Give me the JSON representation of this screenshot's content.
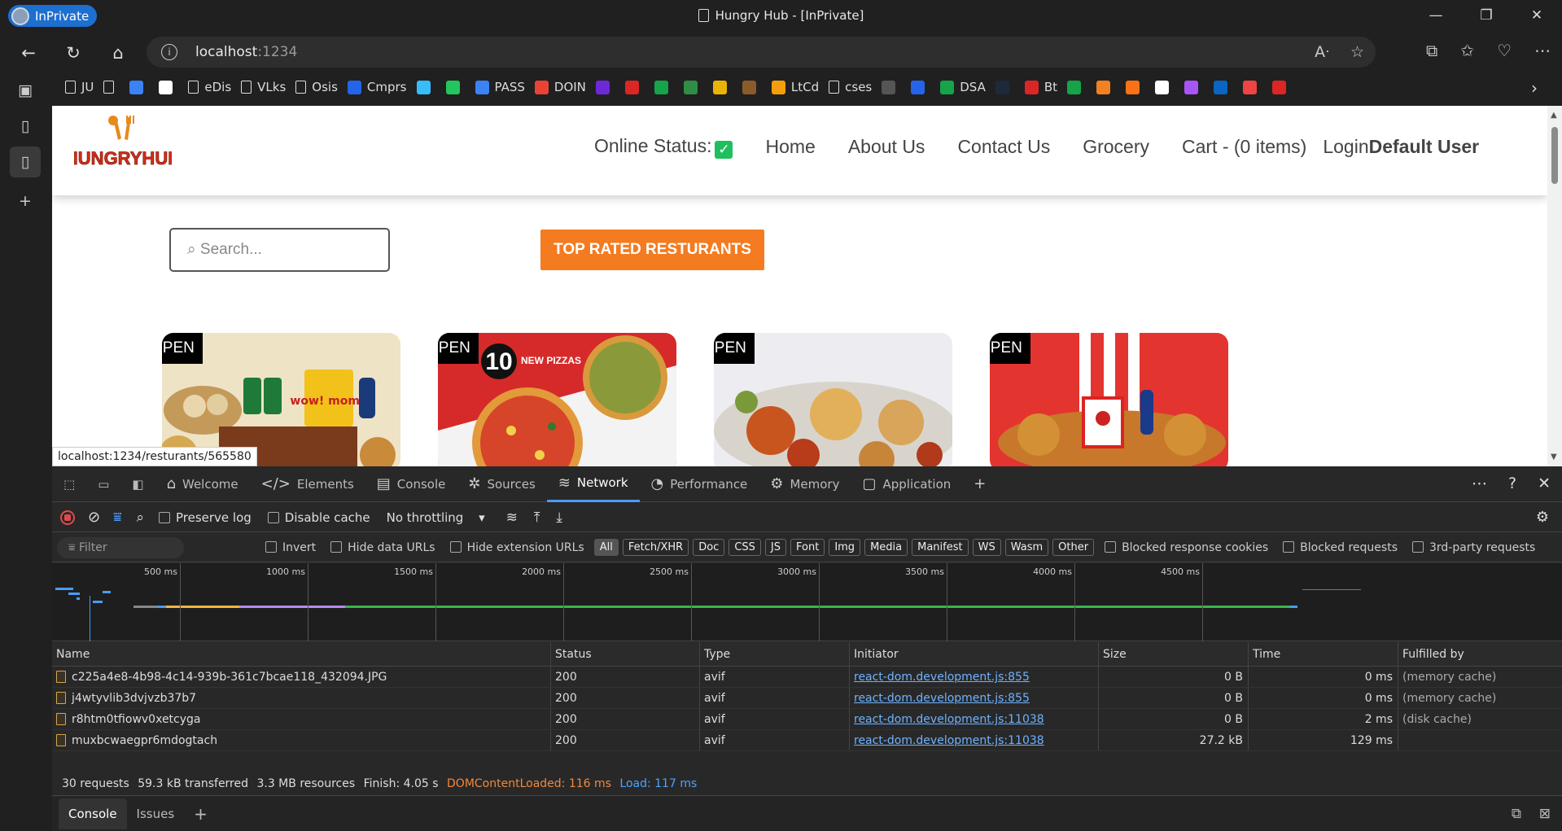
{
  "window": {
    "profile": "InPrivate",
    "title": "Hungry Hub - [InPrivate]"
  },
  "address": {
    "host": "localhost",
    "port": ":1234"
  },
  "bookmarks": [
    {
      "label": "JU",
      "icon": "doc-icon",
      "color": ""
    },
    {
      "label": "",
      "icon": "doc-icon",
      "color": ""
    },
    {
      "label": "",
      "icon": "hex-icon",
      "color": "#3b82f6"
    },
    {
      "label": "",
      "icon": "notion-icon",
      "color": "#ffffff"
    },
    {
      "label": "eDis",
      "icon": "doc-icon",
      "color": ""
    },
    {
      "label": "VLks",
      "icon": "doc-icon",
      "color": ""
    },
    {
      "label": "Osis",
      "icon": "doc-icon",
      "color": ""
    },
    {
      "label": "Cmprs",
      "icon": "circle-icon",
      "color": "#2563eb"
    },
    {
      "label": "",
      "icon": "cloud-icon",
      "color": "#38bdf8"
    },
    {
      "label": "",
      "icon": "drive-icon",
      "color": "#22c55e"
    },
    {
      "label": "PASS",
      "icon": "list-icon",
      "color": "#3b82f6"
    },
    {
      "label": "DOIN",
      "icon": "google-icon",
      "color": "#ea4335"
    },
    {
      "label": "",
      "icon": "u-icon",
      "color": "#6d28d9"
    },
    {
      "label": "",
      "icon": "c-icon",
      "color": "#dc2626"
    },
    {
      "label": "",
      "icon": "hr-icon",
      "color": "#16a34a"
    },
    {
      "label": "",
      "icon": "gfg-icon",
      "color": "#2f8d46"
    },
    {
      "label": "",
      "icon": "chart-icon",
      "color": "#eab308"
    },
    {
      "label": "",
      "icon": "cc-icon",
      "color": "#8b5a2b"
    },
    {
      "label": "LtCd",
      "icon": "leetcode-icon",
      "color": "#f59e0b"
    },
    {
      "label": "cses",
      "icon": "doc-icon",
      "color": ""
    },
    {
      "label": "",
      "icon": "dots-icon",
      "color": "#555555"
    },
    {
      "label": "",
      "icon": "s-icon",
      "color": "#2563eb"
    },
    {
      "label": "DSA",
      "icon": "plus-icon",
      "color": "#16a34a"
    },
    {
      "label": "",
      "icon": "a-icon",
      "color": "#1e293b"
    },
    {
      "label": "Bt",
      "icon": "s-red-icon",
      "color": "#dc2626"
    },
    {
      "label": "",
      "icon": "w-icon",
      "color": "#16a34a"
    },
    {
      "label": "",
      "icon": "stack-icon",
      "color": "#f48024"
    },
    {
      "label": "",
      "icon": "grid-icon",
      "color": "#f97316"
    },
    {
      "label": "",
      "icon": "github-icon",
      "color": "#ffffff"
    },
    {
      "label": "",
      "icon": "u2-icon",
      "color": "#a855f7"
    },
    {
      "label": "",
      "icon": "linkedin-icon",
      "color": "#0a66c2"
    },
    {
      "label": "",
      "icon": "g-icon",
      "color": "#ef4444"
    },
    {
      "label": "",
      "icon": "u3-icon",
      "color": "#dc2626"
    }
  ],
  "site": {
    "nav": {
      "online_status": "Online Status:",
      "home": "Home",
      "about": "About Us",
      "contact": "Contact Us",
      "grocery": "Grocery",
      "cart": "Cart - (0 items)",
      "login": "Login",
      "user": "Default User"
    },
    "search_placeholder": "⌕ Search...",
    "top_rated_label": "TOP RATED RESTURANTS",
    "cards": [
      {
        "badge": "OPEN"
      },
      {
        "badge": "OPEN"
      },
      {
        "badge": "OPEN"
      },
      {
        "badge": "OPEN"
      }
    ],
    "pizza_text_big": "10",
    "pizza_text_small": "NEW PIZZAS",
    "momo_text": "wow! momo"
  },
  "status_link": "localhost:1234/resturants/565580",
  "devtools": {
    "tabs": [
      {
        "label": "Welcome",
        "icon": "home-icon"
      },
      {
        "label": "Elements",
        "icon": "code-icon"
      },
      {
        "label": "Console",
        "icon": "console-icon"
      },
      {
        "label": "Sources",
        "icon": "bug-icon"
      },
      {
        "label": "Network",
        "icon": "wifi-icon"
      },
      {
        "label": "Performance",
        "icon": "gauge-icon"
      },
      {
        "label": "Memory",
        "icon": "chip-icon"
      },
      {
        "label": "Application",
        "icon": "window-icon"
      }
    ],
    "active_tab": "Network",
    "toolbar": {
      "preserve_log": "Preserve log",
      "disable_cache": "Disable cache",
      "throttling": "No throttling"
    },
    "filter": {
      "placeholder": "Filter",
      "invert": "Invert",
      "hide_data": "Hide data URLs",
      "hide_ext": "Hide extension URLs",
      "types": [
        "All",
        "Fetch/XHR",
        "Doc",
        "CSS",
        "JS",
        "Font",
        "Img",
        "Media",
        "Manifest",
        "WS",
        "Wasm",
        "Other"
      ],
      "blocked_cookies": "Blocked response cookies",
      "blocked_requests": "Blocked requests",
      "third_party": "3rd-party requests"
    },
    "timeline_ticks": [
      "500 ms",
      "1000 ms",
      "1500 ms",
      "2000 ms",
      "2500 ms",
      "3000 ms",
      "3500 ms",
      "4000 ms",
      "4500 ms"
    ],
    "columns": [
      "Name",
      "Status",
      "Type",
      "Initiator",
      "Size",
      "Time",
      "Fulfilled by"
    ],
    "rows": [
      {
        "name": "c225a4e8-4b98-4c14-939b-361c7bcae118_432094.JPG",
        "status": "200",
        "type": "avif",
        "initiator": "react-dom.development.js:855",
        "size": "0 B",
        "time": "0 ms",
        "fulfilled": "(memory cache)"
      },
      {
        "name": "j4wtyvlib3dvjvzb37b7",
        "status": "200",
        "type": "avif",
        "initiator": "react-dom.development.js:855",
        "size": "0 B",
        "time": "0 ms",
        "fulfilled": "(memory cache)"
      },
      {
        "name": "r8htm0tfiowv0xetcyga",
        "status": "200",
        "type": "avif",
        "initiator": "react-dom.development.js:11038",
        "size": "0 B",
        "time": "2 ms",
        "fulfilled": "(disk cache)"
      },
      {
        "name": "muxbcwaegpr6mdogtach",
        "status": "200",
        "type": "avif",
        "initiator": "react-dom.development.js:11038",
        "size": "27.2 kB",
        "time": "129 ms",
        "fulfilled": ""
      }
    ],
    "summary": {
      "requests": "30 requests",
      "transferred": "59.3 kB transferred",
      "resources": "3.3 MB resources",
      "finish": "Finish: 4.05 s",
      "dcl": "DOMContentLoaded: 116 ms",
      "load": "Load: 117 ms"
    },
    "drawer": {
      "console": "Console",
      "issues": "Issues"
    }
  }
}
